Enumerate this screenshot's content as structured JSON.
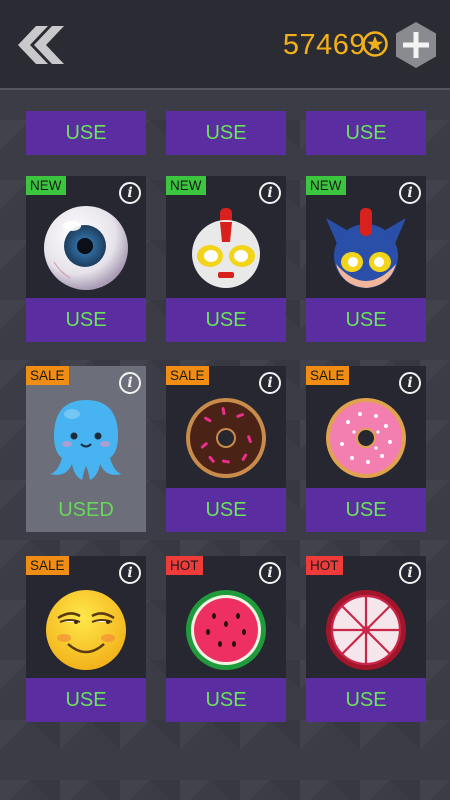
{
  "header": {
    "coins": "57469",
    "back_icon": "double-chevron-left-icon",
    "coin_icon": "star-coin-icon",
    "add_icon": "plus-hexagon-icon"
  },
  "top_row": [
    "USE",
    "USE",
    "USE"
  ],
  "skins": [
    {
      "badge": "NEW",
      "badge_type": "new",
      "art": "eyeball",
      "button": "USE",
      "state": "use"
    },
    {
      "badge": "NEW",
      "badge_type": "new",
      "art": "ultraman",
      "button": "USE",
      "state": "use"
    },
    {
      "badge": "NEW",
      "badge_type": "new",
      "art": "blue-hero",
      "button": "USE",
      "state": "use"
    },
    {
      "badge": "SALE",
      "badge_type": "sale",
      "art": "octopus",
      "button": "USED",
      "state": "used"
    },
    {
      "badge": "SALE",
      "badge_type": "sale",
      "art": "chocolate-donut",
      "button": "USE",
      "state": "use"
    },
    {
      "badge": "SALE",
      "badge_type": "sale",
      "art": "pink-donut",
      "button": "USE",
      "state": "use"
    },
    {
      "badge": "SALE",
      "badge_type": "sale",
      "art": "smug-smiley",
      "button": "USE",
      "state": "use"
    },
    {
      "badge": "HOT",
      "badge_type": "hot",
      "art": "watermelon",
      "button": "USE",
      "state": "use"
    },
    {
      "badge": "HOT",
      "badge_type": "hot",
      "art": "citrus-slice",
      "button": "USE",
      "state": "use"
    }
  ],
  "info_glyph": "i",
  "colors": {
    "accent_coin": "#f2b11b",
    "button_bg": "#5a2ea0",
    "button_text": "#6ae45a",
    "new": "#3cc63f",
    "sale": "#f08d12",
    "hot": "#f03b3b"
  }
}
